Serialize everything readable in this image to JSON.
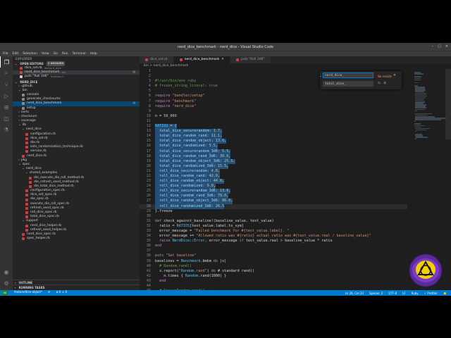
{
  "window": {
    "title": "nerd_dice_benchmark - nerd_dice - Visual Studio Code",
    "controls": [
      "–",
      "▢",
      "✕"
    ]
  },
  "menu": [
    "File",
    "Edit",
    "Selection",
    "View",
    "Go",
    "Run",
    "Terminal",
    "Help"
  ],
  "sidebar": {
    "title": "EXPLORER",
    "open_editors": {
      "label": "OPEN EDITORS",
      "badge": "2 UNSAVED"
    },
    "open_files": [
      {
        "name": "dice_set.rb",
        "desc": "lib/nerd_dice",
        "stat": "",
        "icon": "#cc3e44"
      },
      {
        "name": "nerd_dice_benchmark",
        "desc": "bin",
        "stat": "M",
        "icon": "#cc3e44"
      },
      {
        "name": "puts \"Roll 3d6\"",
        "desc": "Untitled-1",
        "stat": "",
        "icon": "#cccccc"
      }
    ],
    "project": "NERD_DICE",
    "tree": [
      {
        "name": ".github",
        "depth": 1,
        "folder": true
      },
      {
        "name": "bin",
        "depth": 1,
        "folder": true,
        "open": true
      },
      {
        "name": "console",
        "depth": 2
      },
      {
        "name": "generate_checksums",
        "depth": 2
      },
      {
        "name": "nerd_dice_benchmark",
        "depth": 2,
        "stat": "M",
        "sel": true
      },
      {
        "name": "setup",
        "depth": 2
      },
      {
        "name": "certs",
        "depth": 1,
        "folder": true
      },
      {
        "name": "checksum",
        "depth": 1,
        "folder": true
      },
      {
        "name": "coverage",
        "depth": 1,
        "folder": true
      },
      {
        "name": "lib",
        "depth": 1,
        "folder": true,
        "open": true
      },
      {
        "name": "nerd_dice",
        "depth": 2,
        "folder": true,
        "open": true
      },
      {
        "name": "configuration.rb",
        "depth": 3
      },
      {
        "name": "dice_set.rb",
        "depth": 3
      },
      {
        "name": "die.rb",
        "depth": 3
      },
      {
        "name": "sets_randomization_technique.rb",
        "depth": 3
      },
      {
        "name": "version.rb",
        "depth": 3
      },
      {
        "name": "nerd_dice.rb",
        "depth": 2
      },
      {
        "name": "pkg",
        "depth": 1,
        "folder": true
      },
      {
        "name": "spec",
        "depth": 1,
        "folder": true,
        "open": true
      },
      {
        "name": "nerd_dice",
        "depth": 2,
        "folder": true,
        "open": true
      },
      {
        "name": "shared_examples",
        "depth": 3,
        "folder": true,
        "open": true
      },
      {
        "name": "die_execute_die_roll_method.rb",
        "depth": 4
      },
      {
        "name": "die_refresh_seed_method.rb",
        "depth": 4
      },
      {
        "name": "die_total_dice_method.rb",
        "depth": 4
      },
      {
        "name": "configuration_spec.rb",
        "depth": 3
      },
      {
        "name": "dice_set_spec.rb",
        "depth": 3
      },
      {
        "name": "die_spec.rb",
        "depth": 3
      },
      {
        "name": "execute_die_roll_spec.rb",
        "depth": 3
      },
      {
        "name": "refresh_seed_spec.rb",
        "depth": 3
      },
      {
        "name": "roll_dice_spec.rb",
        "depth": 3
      },
      {
        "name": "total_dice_spec.rb",
        "depth": 3
      },
      {
        "name": "support",
        "depth": 2,
        "folder": true,
        "open": true
      },
      {
        "name": "nerd_dice_helper.rb",
        "depth": 3
      },
      {
        "name": "refresh_seed_helper.rb",
        "depth": 3
      },
      {
        "name": "nerd_dice_spec.rb",
        "depth": 2
      },
      {
        "name": "spec_helper.rb",
        "depth": 2
      }
    ],
    "outline": "OUTLINE",
    "running_tasks": "RUNNING TASKS"
  },
  "tabs": [
    {
      "label": "dice_set.rb",
      "active": false
    },
    {
      "label": "nerd_dice_benchmark",
      "active": true
    },
    {
      "label": "puts \"Roll 3d6\"",
      "active": false
    }
  ],
  "breadcrumbs": "bin  >  nerd_dice_benchmark",
  "find": {
    "find_value": "nerd_dice_",
    "replace_value": "total_dice_",
    "results": "No results"
  },
  "code_lines": [
    "",
    "",
    "#!/usr/bin/env ruby",
    "# frozen_string_literal: true",
    "",
    "require \"bundler/setup\"",
    "require \"benchmark\"",
    "require \"nerd_dice\"",
    "",
    "n = 50_000",
    "",
    "RATIOS = {",
    "  total_dice_securerandom: 1.7,",
    "  total_dice_random_rand: 11.1,",
    "  total_dice_random_object: 13.0,",
    "  total_dice_randomized: 5.5,",
    "  total_dice_securerandom_3d6: 5.5,",
    "  total_dice_random_rand_3d6: 30.0,",
    "  total_dice_random_object_3d6: 25.5,",
    "  total_dice_randomized_3d6: 15.5,",
    "  roll_dice_securerandom: 4.0,",
    "  roll_dice_random_rand: 42.0,",
    "  roll_dice_random_object: 44.0,",
    "  roll_dice_randomized: 9.0,",
    "  roll_dice_securerandom_3d6: 13.0,",
    "  roll_dice_random_rand_3d6: 79.0,",
    "  roll_dice_random_object_3d6: 86.0,",
    "  roll_dice_randomized_3d6: 26.5",
    "}.freeze",
    "",
    "def check_against_baseline!(baseline_value, test_value)",
    "  ratio = RATIOS[test_value.label.to_sym]",
    "  error_message = \"Failed benchmark for #{test_value.label}. \"",
    "  error_message += \"Allowed ratio was #{ratio} actual ratio was #{test_value.real / baseline_value}\"",
    "  raise NerdDice::Error, error_message if test_value.real > baseline_value * ratio",
    "end",
    "",
    "puts \"Set baseline\"",
    "baselines = Benchmark.bmbm do |x|",
    "  # Random.rand()",
    "  x.report(\"Random.rand\") do # standard rand()",
    "    n.times { Random.rand(1000) }",
    "  end",
    "",
    "  # SecureRandom.rand()",
    "  x.report(\"Sec.rand\") do",
    "    n.times { SecureRandom.rand(1000) }",
    "  end"
  ],
  "status": {
    "branch": "feature/dice-object*",
    "sync": "⟳",
    "problems": "⊗ 0  ⚠ 0",
    "cursor": "Ln 26, Col 33",
    "spaces": "Spaces: 2",
    "encoding": "UTF-8",
    "eol": "LF",
    "language": "Ruby",
    "prettier": "✓ Prettier"
  },
  "colors": {
    "statusbar": "#007acc",
    "comment": "#6a9955",
    "string": "#ce9178",
    "keyword": "#c586c0",
    "number": "#b5cea8",
    "constant": "#4fc1ff",
    "symbol": "#9cdcfe",
    "logo_purple": "#5b2a9a",
    "logo_yellow": "#f5d000"
  }
}
